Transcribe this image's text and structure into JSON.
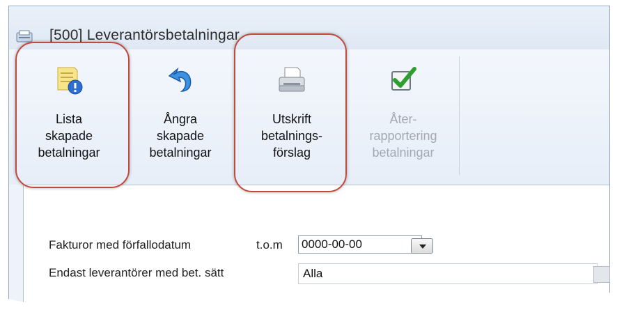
{
  "window": {
    "title": "[500]  Leverantörsbetalningar"
  },
  "ribbon": {
    "buttons": [
      {
        "label": "Lista\nskapade\nbetalningar",
        "icon": "list-info-icon",
        "enabled": true
      },
      {
        "label": "Ångra\nskapade\nbetalningar",
        "icon": "undo-icon",
        "enabled": true
      },
      {
        "label": "Utskrift\nbetalnings-\nförslag",
        "icon": "printer-icon",
        "enabled": true
      },
      {
        "label": "Åter-\nrapportering\nbetalningar",
        "icon": "checkbox-check-icon",
        "enabled": false
      }
    ]
  },
  "form": {
    "due_date": {
      "label": "Fakturor med förfallodatum",
      "qualifier": "t.o.m",
      "value": "0000-00-00"
    },
    "payment_method": {
      "label": "Endast leverantörer med bet. sätt",
      "value": "Alla"
    }
  },
  "colors": {
    "highlight": "#c24a3b",
    "check_green": "#2e9e2e",
    "disabled_text": "#a3a9b2"
  }
}
